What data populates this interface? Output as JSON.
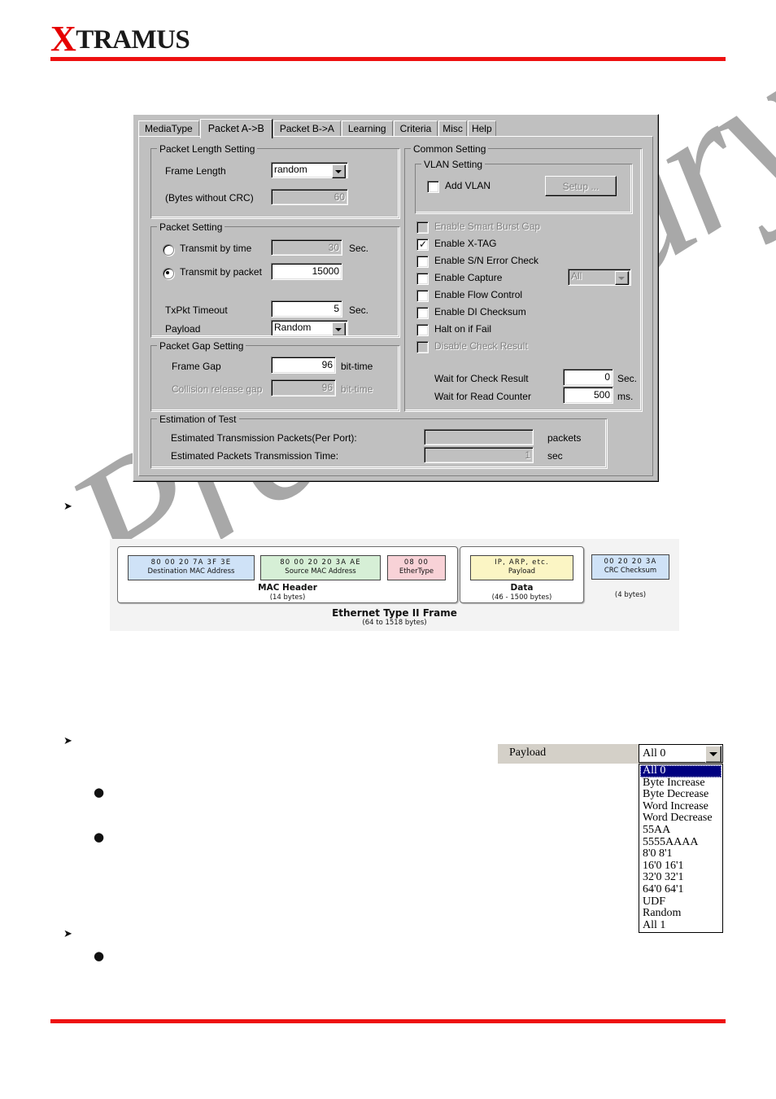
{
  "brand": {
    "x": "X",
    "name": "TRAMUS",
    "accent": "#ee1111"
  },
  "dialog": {
    "tabs": [
      {
        "label": "MediaType",
        "selected": false
      },
      {
        "label": "Packet A->B",
        "selected": true
      },
      {
        "label": "Packet B->A",
        "selected": false
      },
      {
        "label": "Learning",
        "selected": false
      },
      {
        "label": "Criteria",
        "selected": false
      },
      {
        "label": "Misc",
        "selected": false
      },
      {
        "label": "Help",
        "selected": false
      }
    ],
    "packet_length": {
      "group_title": "Packet Length Setting",
      "frame_length_label": "Frame Length",
      "frame_length_value": "random",
      "bytes_label": "(Bytes without CRC)",
      "bytes_value": "60"
    },
    "packet_setting": {
      "group_title": "Packet Setting",
      "transmit_by_time_label": "Transmit by time",
      "transmit_by_time_value": "30",
      "transmit_by_time_unit": "Sec.",
      "transmit_by_time_selected": false,
      "transmit_by_packet_label": "Transmit by packet",
      "transmit_by_packet_value": "15000",
      "transmit_by_packet_selected": true,
      "txpkt_timeout_label": "TxPkt Timeout",
      "txpkt_timeout_value": "5",
      "txpkt_timeout_unit": "Sec.",
      "payload_label": "Payload",
      "payload_value": "Random"
    },
    "packet_gap": {
      "group_title": "Packet Gap Setting",
      "frame_gap_label": "Frame Gap",
      "frame_gap_value": "96",
      "frame_gap_unit": "bit-time",
      "collision_label": "Collision release gap",
      "collision_value": "96",
      "collision_unit": "bit-time"
    },
    "common": {
      "group_title": "Common Setting",
      "vlan_group_title": "VLAN Setting",
      "add_vlan_label": "Add VLAN",
      "add_vlan_checked": false,
      "setup_button": "Setup ...",
      "checkboxes": [
        {
          "label": "Enable Smart Burst Gap",
          "checked": false,
          "disabled": true
        },
        {
          "label": "Enable X-TAG",
          "checked": true,
          "disabled": false
        },
        {
          "label": "Enable S/N Error Check",
          "checked": false,
          "disabled": false
        },
        {
          "label": "Enable Capture",
          "checked": false,
          "disabled": false
        },
        {
          "label": "Enable Flow Control",
          "checked": false,
          "disabled": false
        },
        {
          "label": "Enable DI Checksum",
          "checked": false,
          "disabled": false
        },
        {
          "label": "Halt on if Fail",
          "checked": false,
          "disabled": false
        },
        {
          "label": "Disable Check Result",
          "checked": false,
          "disabled": true
        }
      ],
      "capture_combo_value": "All",
      "wait_check_label": "Wait for Check Result",
      "wait_check_value": "0",
      "wait_check_unit": "Sec.",
      "wait_read_label": "Wait for Read Counter",
      "wait_read_value": "500",
      "wait_read_unit": "ms."
    },
    "estimation": {
      "group_title": "Estimation of Test",
      "packets_label": "Estimated Transmission Packets(Per Port):",
      "packets_value": "",
      "packets_unit": "packets",
      "time_label": "Estimated Packets Transmission Time:",
      "time_value": "1",
      "time_unit": "sec"
    }
  },
  "frame_figure": {
    "cells": [
      {
        "hex": "80  00  20  7A  3F  3E",
        "name": "Destination MAC Address",
        "color": "#cfe2f7"
      },
      {
        "hex": "80  00  20  20  3A  AE",
        "name": "Source MAC Address",
        "color": "#d6efd6"
      },
      {
        "hex": "08  00",
        "name": "EtherType",
        "color": "#f8d2d7"
      },
      {
        "hex": "IP, ARP, etc.",
        "name": "Payload",
        "color": "#fbf5c4"
      },
      {
        "hex": "00  20  20  3A",
        "name": "CRC Checksum",
        "color": "#cfe2f7"
      }
    ],
    "captions": [
      {
        "title": "MAC Header",
        "sub": "(14 bytes)"
      },
      {
        "title": "Data",
        "sub": "(46 - 1500 bytes)"
      },
      {
        "title": "",
        "sub": "(4 bytes)"
      }
    ],
    "title": "Ethernet Type II Frame",
    "subtitle": "(64 to 1518 bytes)"
  },
  "payload_dropdown": {
    "label": "Payload",
    "selected": "All 0",
    "options": [
      "All 0",
      "Byte Increase",
      "Byte Decrease",
      "Word Increase",
      "Word Decrease",
      "55AA",
      "5555AAAA",
      "8'0 8'1",
      "16'0 16'1",
      "32'0 32'1",
      "64'0 64'1",
      "UDF",
      "Random",
      "All 1"
    ]
  },
  "watermark": {
    "text": "Preliminary"
  },
  "bullets": {
    "arrow": "➤",
    "dot": "●"
  }
}
